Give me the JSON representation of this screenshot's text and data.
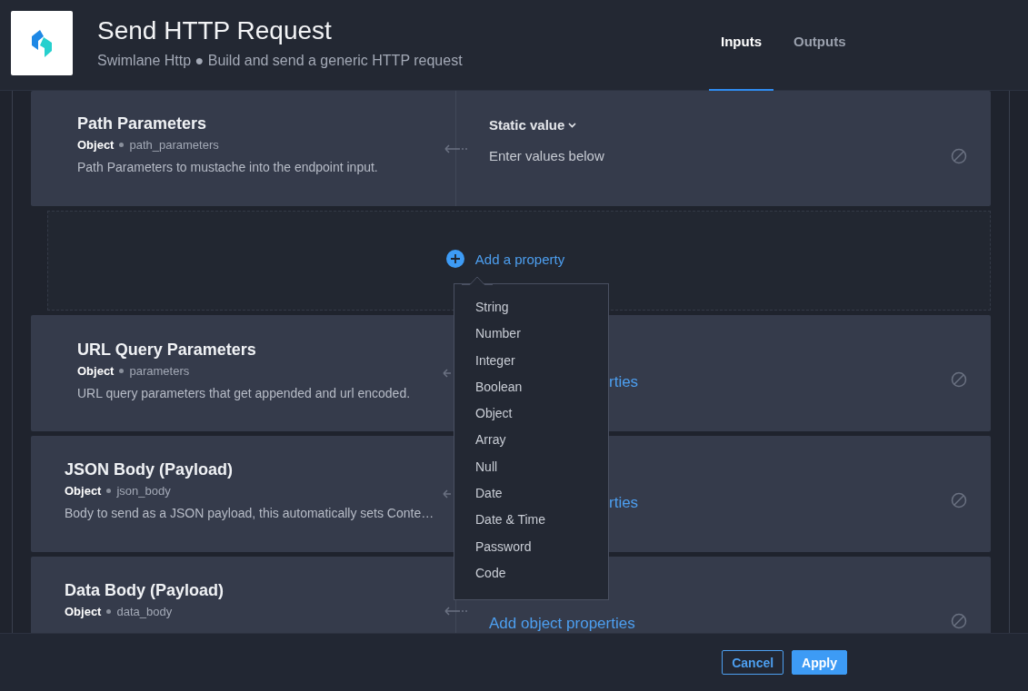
{
  "header": {
    "title": "Send HTTP Request",
    "subtitle": "Swimlane Http ● Build and send a generic HTTP request"
  },
  "tabs": [
    {
      "label": "Inputs",
      "selected": true
    },
    {
      "label": "Outputs",
      "selected": false
    }
  ],
  "top_card": {
    "title": "Path Parameters",
    "type": "Object",
    "key": "path_parameters",
    "description": "Path Parameters to mustache into the endpoint input.",
    "mode": "Static value",
    "hint": "Enter values below"
  },
  "add_property": {
    "label": "Add a property",
    "menu": [
      "String",
      "Number",
      "Integer",
      "Boolean",
      "Object",
      "Array",
      "Null",
      "Date",
      "Date & Time",
      "Password",
      "Code"
    ]
  },
  "cards": [
    {
      "title": "URL Query Parameters",
      "type": "Object",
      "key": "parameters",
      "description": "URL query parameters that get appended and url encoded.",
      "link": "rties"
    },
    {
      "title": "JSON Body (Payload)",
      "type": "Object",
      "key": "json_body",
      "description": "Body to send as a JSON payload, this automatically sets Conte…",
      "link": "rties"
    },
    {
      "title": "Data Body (Payload)",
      "type": "Object",
      "key": "data_body",
      "link": "Add object properties"
    }
  ],
  "footer": {
    "buttons": [
      {
        "label": "Cancel",
        "kind": "secondary"
      },
      {
        "label": "Apply",
        "kind": "primary"
      }
    ]
  }
}
